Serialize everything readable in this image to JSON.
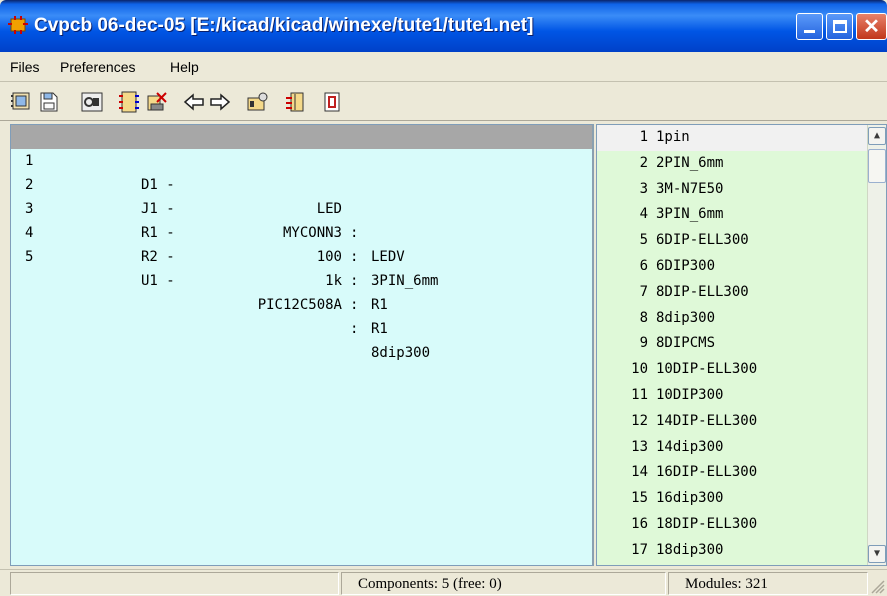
{
  "window": {
    "title": "Cvpcb 06-dec-05 [E:/kicad/kicad/winexe/tute1/tute1.net]",
    "close_glyph": "✕"
  },
  "menu": [
    "Files",
    "Preferences",
    "Help"
  ],
  "toolbar": {
    "buttons": [
      "load-netlist-icon",
      "save-icon",
      "view-footprint-icon",
      "auto-associate-icon",
      "delete-associations-icon",
      "previous-icon",
      "next-icon",
      "library-config-icon",
      "footprint-list-icon",
      "doc-icon"
    ]
  },
  "components": [
    {
      "num": "1",
      "ref": "D1 -",
      "value": "LED",
      "sep": ":",
      "footprint": "LEDV"
    },
    {
      "num": "2",
      "ref": "J1 -",
      "value": "MYCONN3",
      "sep": ":",
      "footprint": "3PIN_6mm"
    },
    {
      "num": "3",
      "ref": "R1 -",
      "value": "100",
      "sep": ":",
      "footprint": "R1"
    },
    {
      "num": "4",
      "ref": "R2 -",
      "value": "1k",
      "sep": ":",
      "footprint": "R1"
    },
    {
      "num": "5",
      "ref": "U1 -",
      "value": "PIC12C508A",
      "sep": ":",
      "footprint": "8dip300"
    }
  ],
  "modules": [
    {
      "num": "1",
      "name": "1pin"
    },
    {
      "num": "2",
      "name": "2PIN_6mm"
    },
    {
      "num": "3",
      "name": "3M-N7E50"
    },
    {
      "num": "4",
      "name": "3PIN_6mm"
    },
    {
      "num": "5",
      "name": "6DIP-ELL300"
    },
    {
      "num": "6",
      "name": "6DIP300"
    },
    {
      "num": "7",
      "name": "8DIP-ELL300"
    },
    {
      "num": "8",
      "name": "8dip300"
    },
    {
      "num": "9",
      "name": "8DIPCMS"
    },
    {
      "num": "10",
      "name": "10DIP-ELL300"
    },
    {
      "num": "11",
      "name": "10DIP300"
    },
    {
      "num": "12",
      "name": "14DIP-ELL300"
    },
    {
      "num": "13",
      "name": "14dip300"
    },
    {
      "num": "14",
      "name": "16DIP-ELL300"
    },
    {
      "num": "15",
      "name": "16dip300"
    },
    {
      "num": "16",
      "name": "18DIP-ELL300"
    },
    {
      "num": "17",
      "name": "18dip300"
    }
  ],
  "status": {
    "pane0": "",
    "components": "Components: 5 (free: 0)",
    "modules": "Modules: 321"
  },
  "scroll": {
    "up": "▲",
    "down": "▼"
  },
  "colors": {
    "component_bg": "#d8fbfa",
    "module_bg": "#dff9d8",
    "selected_row": "#a7a7a7",
    "titlebar": "#0055e5"
  }
}
